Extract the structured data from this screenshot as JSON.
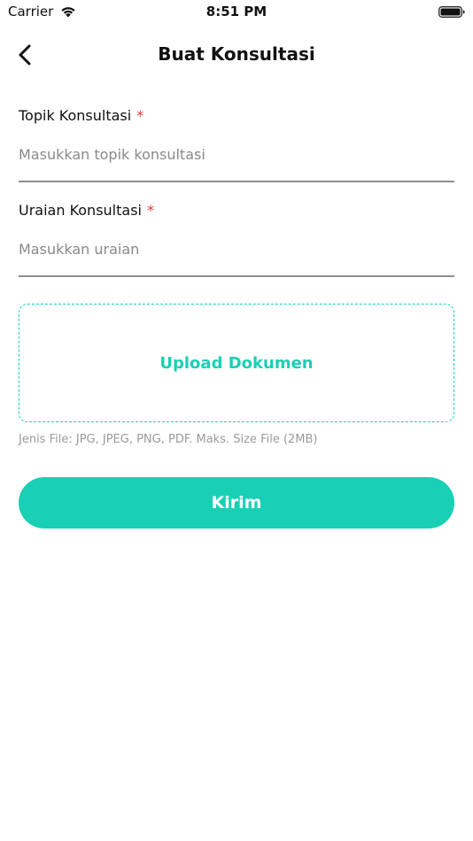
{
  "status_bar": {
    "carrier": "Carrier",
    "time": "8:51 PM"
  },
  "nav": {
    "title": "Buat Konsultasi",
    "back_icon": "chevron-left-icon"
  },
  "form": {
    "topic": {
      "label": "Topik Konsultasi",
      "required_mark": "*",
      "value": "",
      "placeholder": "Masukkan topik konsultasi"
    },
    "description": {
      "label": "Uraian Konsultasi",
      "required_mark": "*",
      "value": "",
      "placeholder": "Masukkan uraian"
    },
    "upload": {
      "label": "Upload Dokumen",
      "hint": "Jenis File: JPG, JPEG, PNG, PDF. Maks. Size File (2MB)"
    },
    "submit_label": "Kirim"
  },
  "colors": {
    "accent": "#19d0b4",
    "required": "#e53935",
    "placeholder": "#8a8a8a",
    "hint": "#9a9a9a"
  }
}
